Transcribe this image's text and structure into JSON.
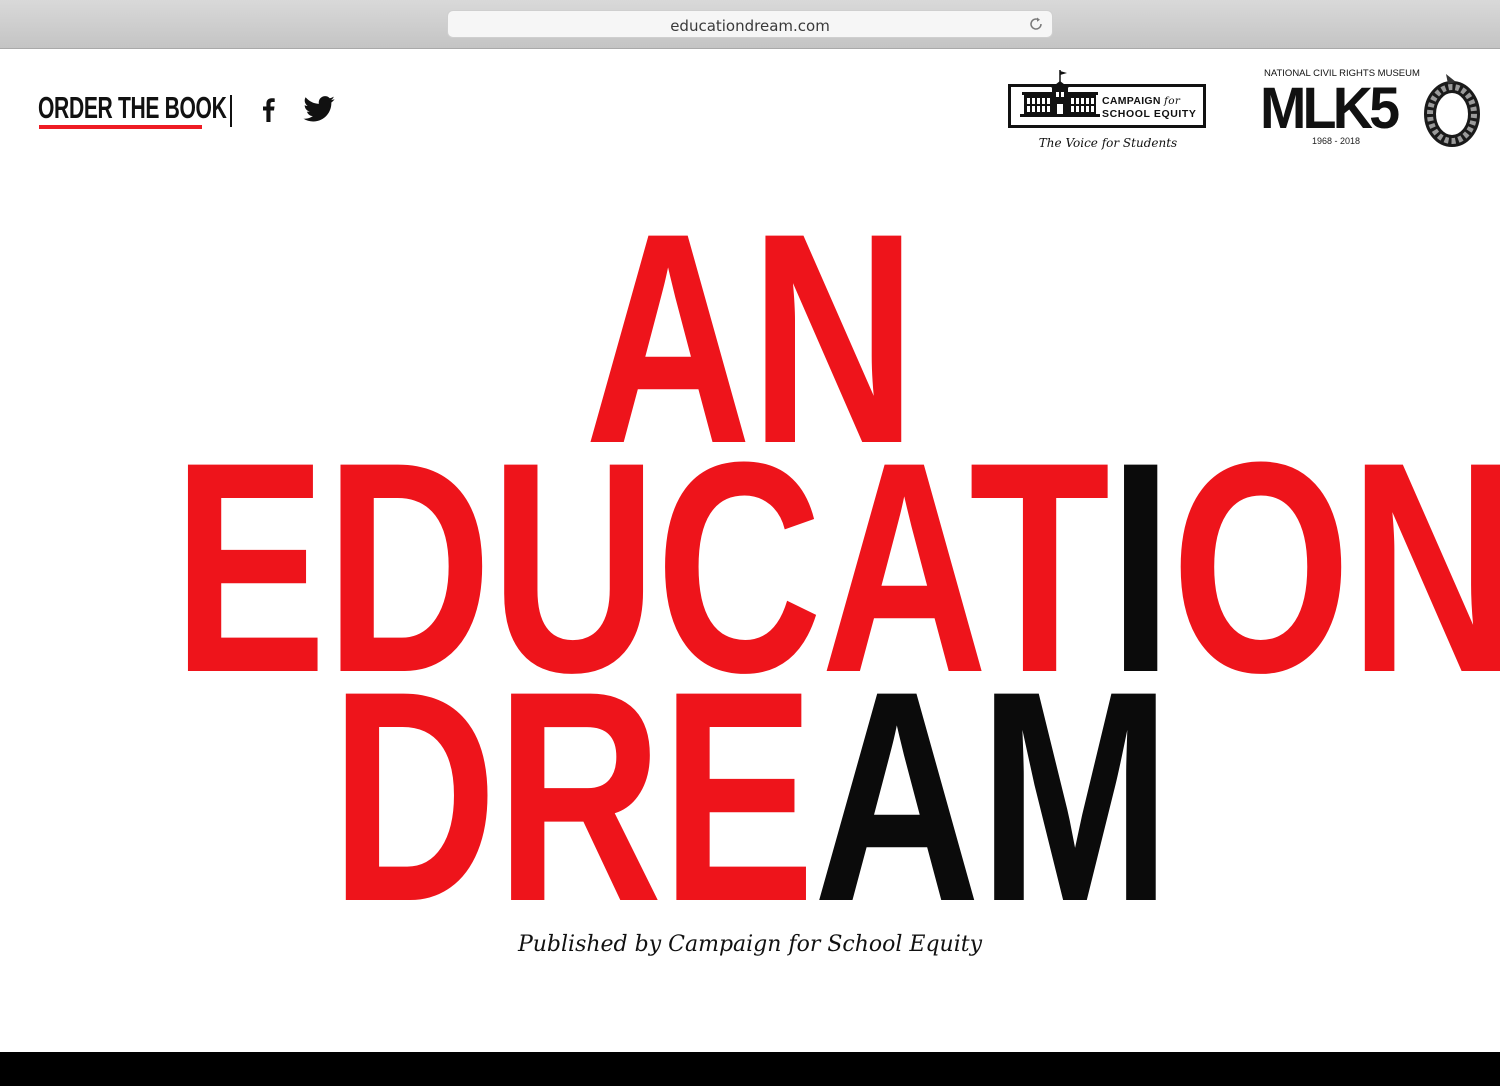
{
  "browser": {
    "url": "educationdream.com"
  },
  "header": {
    "order_label": "ORDER THE BOOK",
    "social": [
      "facebook-icon",
      "twitter-icon"
    ]
  },
  "logos": {
    "cse": {
      "line1": "CAMPAIGN",
      "line1_for": "for",
      "line2": "SCHOOL EQUITY",
      "tagline": "The Voice for Students"
    },
    "mlk": {
      "top": "NATIONAL CIVIL RIGHTS MUSEUM",
      "main": "MLK5",
      "years": "1968 - 2018"
    }
  },
  "headline": {
    "line1_red": "AN",
    "line2_red_a": "EDUCAT",
    "line2_black": "I",
    "line2_red_b": "ON",
    "line3_red": "DRE",
    "line3_black": "AM"
  },
  "publisher": "Published by Campaign for School Equity",
  "colors": {
    "accent": "#ee141b",
    "dark": "#0b0b0b",
    "footer": "#000000"
  }
}
